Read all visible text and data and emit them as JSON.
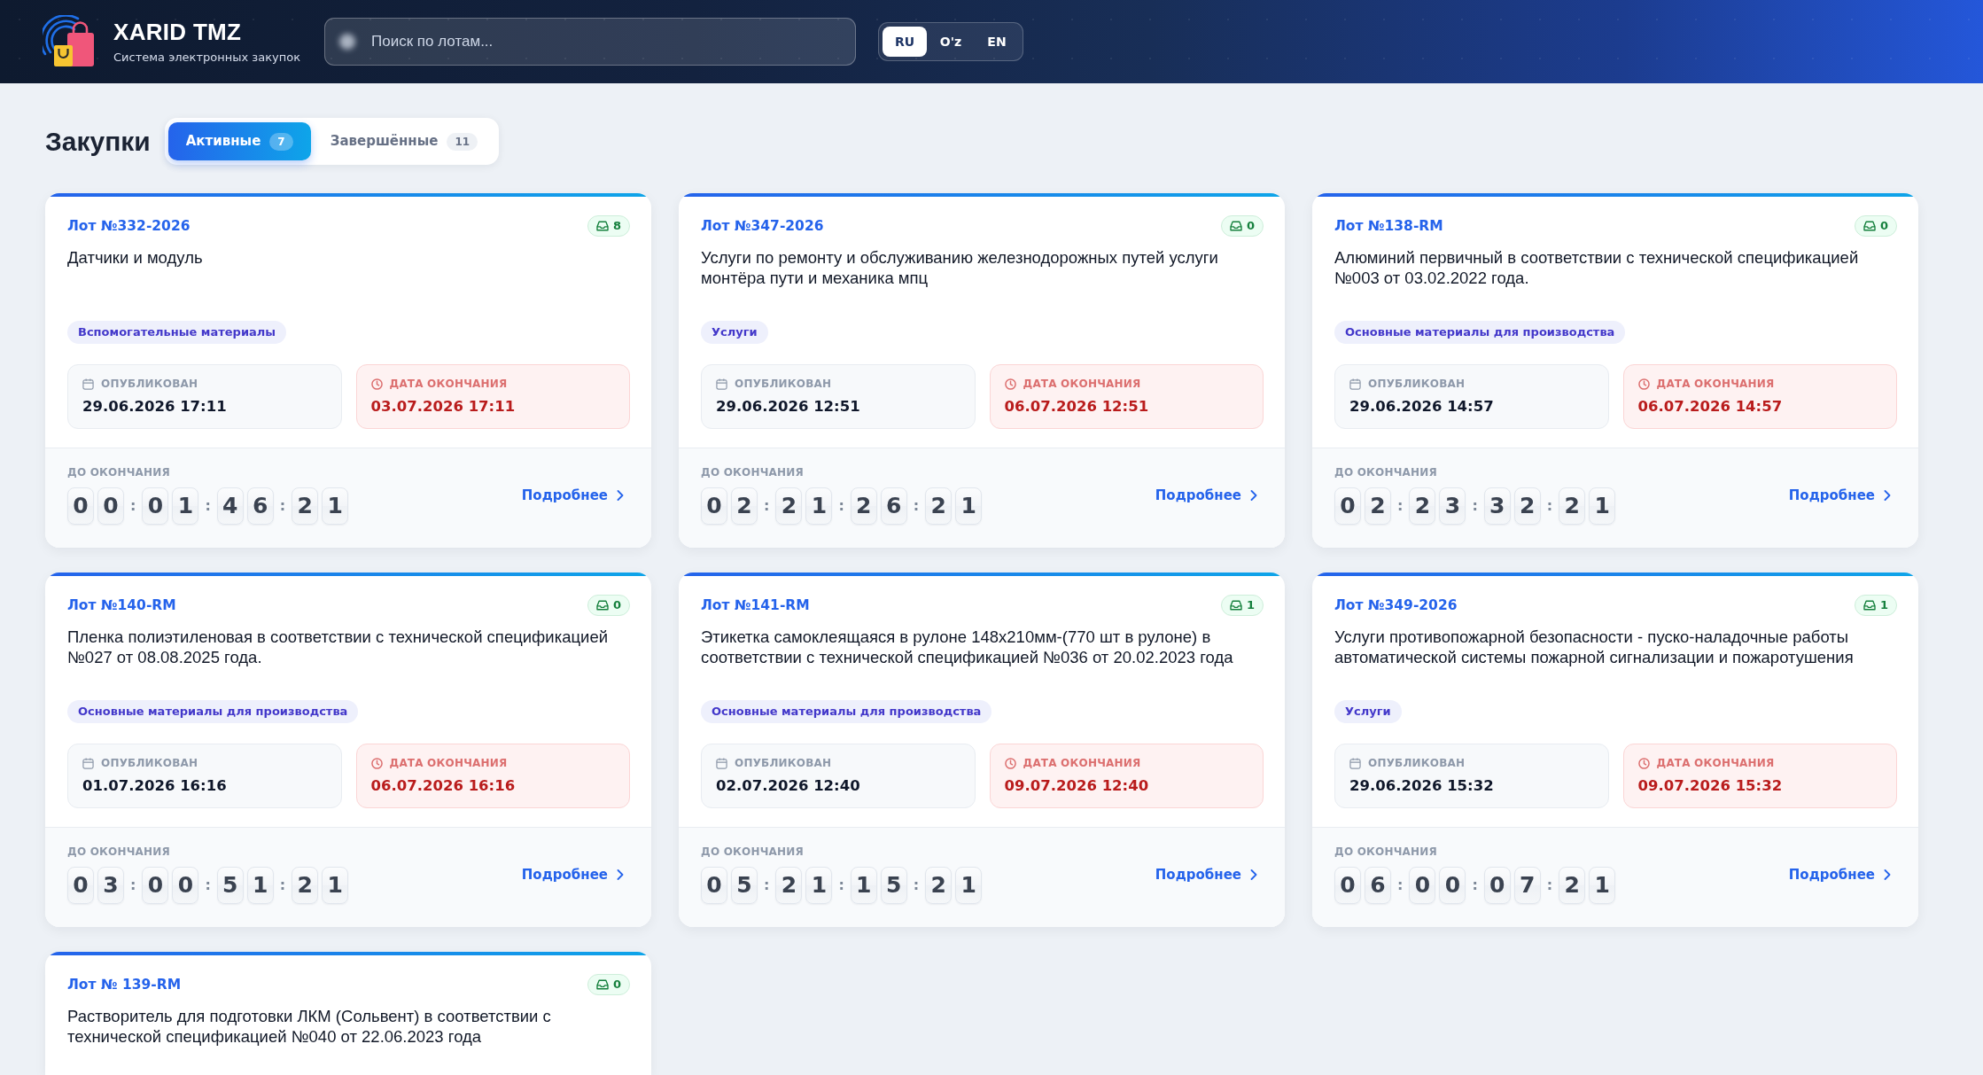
{
  "header": {
    "brand": {
      "title": "XARID TMZ",
      "subtitle": "Система электронных закупок"
    },
    "search": {
      "placeholder": "Поиск по лотам..."
    },
    "languages": [
      {
        "label": "RU",
        "selected": true
      },
      {
        "label": "O'z",
        "selected": false
      },
      {
        "label": "EN",
        "selected": false
      }
    ]
  },
  "page": {
    "title": "Закупки",
    "tabs": [
      {
        "label": "Активные",
        "count": "7",
        "selected": true
      },
      {
        "label": "Завершённые",
        "count": "11",
        "selected": false
      }
    ]
  },
  "lots": [
    {
      "lot": "Лот №332-2026",
      "bids": "8",
      "description": "Датчики и модуль",
      "category": "Вспомогательные материалы",
      "published": {
        "label": "ОПУБЛИКОВАН",
        "value": "29.06.2026 17:11"
      },
      "deadline": {
        "label": "ДАТА ОКОНЧАНИЯ",
        "value": "03.07.2026 17:11"
      },
      "countdown": {
        "label": "ДО ОКОНЧАНИЯ",
        "groups": [
          {
            "digits": [
              "0",
              "0"
            ],
            "separator": ":"
          },
          {
            "digits": [
              "0",
              "1"
            ],
            "separator": ":"
          },
          {
            "digits": [
              "4",
              "6"
            ],
            "separator": ":"
          },
          {
            "digits": [
              "2",
              "1"
            ]
          }
        ]
      },
      "link": "Подробнее"
    },
    {
      "lot": "Лот №347-2026",
      "bids": "0",
      "description": "Услуги по ремонту и обслуживанию железнодорожных путей услуги монтёра пути и механика мпц",
      "category": "Услуги",
      "published": {
        "label": "ОПУБЛИКОВАН",
        "value": "29.06.2026 12:51"
      },
      "deadline": {
        "label": "ДАТА ОКОНЧАНИЯ",
        "value": "06.07.2026 12:51"
      },
      "countdown": {
        "label": "ДО ОКОНЧАНИЯ",
        "groups": [
          {
            "digits": [
              "0",
              "2"
            ],
            "separator": ":"
          },
          {
            "digits": [
              "2",
              "1"
            ],
            "separator": ":"
          },
          {
            "digits": [
              "2",
              "6"
            ],
            "separator": ":"
          },
          {
            "digits": [
              "2",
              "1"
            ]
          }
        ]
      },
      "link": "Подробнее"
    },
    {
      "lot": "Лот №138-RM",
      "bids": "0",
      "description": "Алюминий первичный в соответствии с технической спецификацией №003 от 03.02.2022 года.",
      "category": "Основные материалы для производства",
      "published": {
        "label": "ОПУБЛИКОВАН",
        "value": "29.06.2026 14:57"
      },
      "deadline": {
        "label": "ДАТА ОКОНЧАНИЯ",
        "value": "06.07.2026 14:57"
      },
      "countdown": {
        "label": "ДО ОКОНЧАНИЯ",
        "groups": [
          {
            "digits": [
              "0",
              "2"
            ],
            "separator": ":"
          },
          {
            "digits": [
              "2",
              "3"
            ],
            "separator": ":"
          },
          {
            "digits": [
              "3",
              "2"
            ],
            "separator": ":"
          },
          {
            "digits": [
              "2",
              "1"
            ]
          }
        ]
      },
      "link": "Подробнее"
    },
    {
      "lot": "Лот №140-RM",
      "bids": "0",
      "description": "Пленка полиэтиленовая в соответствии с технической спецификацией №027 от 08.08.2025 года.",
      "category": "Основные материалы для производства",
      "published": {
        "label": "ОПУБЛИКОВАН",
        "value": "01.07.2026 16:16"
      },
      "deadline": {
        "label": "ДАТА ОКОНЧАНИЯ",
        "value": "06.07.2026 16:16"
      },
      "countdown": {
        "label": "ДО ОКОНЧАНИЯ",
        "groups": [
          {
            "digits": [
              "0",
              "3"
            ],
            "separator": ":"
          },
          {
            "digits": [
              "0",
              "0"
            ],
            "separator": ":"
          },
          {
            "digits": [
              "5",
              "1"
            ],
            "separator": ":"
          },
          {
            "digits": [
              "2",
              "1"
            ]
          }
        ]
      },
      "link": "Подробнее"
    },
    {
      "lot": "Лот №141-RM",
      "bids": "1",
      "description": "Этикетка самоклеящаяся в рулоне 148х210мм-(770 шт в рулоне) в соответствии с технической спецификацией №036 от 20.02.2023 года",
      "category": "Основные материалы для производства",
      "published": {
        "label": "ОПУБЛИКОВАН",
        "value": "02.07.2026 12:40"
      },
      "deadline": {
        "label": "ДАТА ОКОНЧАНИЯ",
        "value": "09.07.2026 12:40"
      },
      "countdown": {
        "label": "ДО ОКОНЧАНИЯ",
        "groups": [
          {
            "digits": [
              "0",
              "5"
            ],
            "separator": ":"
          },
          {
            "digits": [
              "2",
              "1"
            ],
            "separator": ":"
          },
          {
            "digits": [
              "1",
              "5"
            ],
            "separator": ":"
          },
          {
            "digits": [
              "2",
              "1"
            ]
          }
        ]
      },
      "link": "Подробнее"
    },
    {
      "lot": "Лот №349-2026",
      "bids": "1",
      "description": "Услуги противопожарной безопасности - пуско-наладочные работы автоматической системы пожарной сигнализации и пожаротушения",
      "category": "Услуги",
      "published": {
        "label": "ОПУБЛИКОВАН",
        "value": "29.06.2026 15:32"
      },
      "deadline": {
        "label": "ДАТА ОКОНЧАНИЯ",
        "value": "09.07.2026 15:32"
      },
      "countdown": {
        "label": "ДО ОКОНЧАНИЯ",
        "groups": [
          {
            "digits": [
              "0",
              "6"
            ],
            "separator": ":"
          },
          {
            "digits": [
              "0",
              "0"
            ],
            "separator": ":"
          },
          {
            "digits": [
              "0",
              "7"
            ],
            "separator": ":"
          },
          {
            "digits": [
              "2",
              "1"
            ]
          }
        ]
      },
      "link": "Подробнее"
    },
    {
      "lot": "Лот № 139-RM",
      "bids": "0",
      "description": "Растворитель для подготовки ЛКМ (Сольвент) в соответствии с технической спецификацией №040 от 22.06.2023 года"
    }
  ]
}
